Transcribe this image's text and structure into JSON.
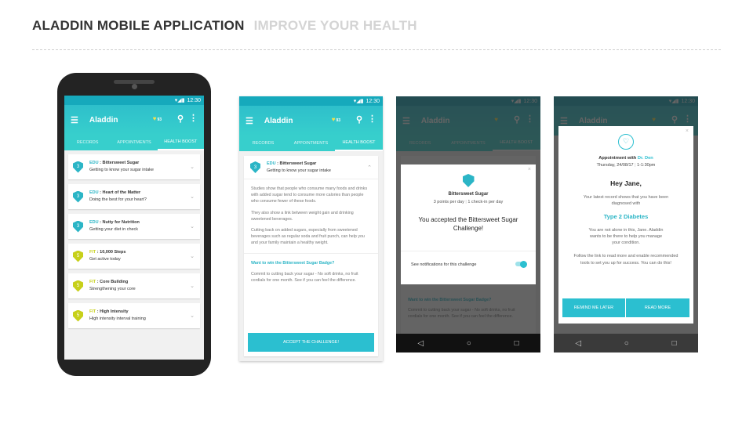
{
  "header": {
    "title": "ALADDIN MOBILE APPLICATION",
    "subtitle": "IMPROVE YOUR HEALTH"
  },
  "colors": {
    "teal": "#2ebfcb",
    "fit": "#c7d01a",
    "edu": "#2bb5c6"
  },
  "app": {
    "title": "Aladdin",
    "points": "93",
    "time": "12:30",
    "status_icons": "▾◢▮",
    "tabs": [
      "RECORDS",
      "APPOINTMENTS",
      "HEALTH BOOST"
    ]
  },
  "cards": [
    {
      "cat": "EDU",
      "title": "Bittersweet Sugar",
      "sub": "Getting to know your sugar intake",
      "num": "3",
      "type": "edu"
    },
    {
      "cat": "EDU",
      "title": "Heart of the Matter",
      "sub": "Doing the best for your heart?",
      "num": "3",
      "type": "edu"
    },
    {
      "cat": "EDU",
      "title": "Nutty for Nutrition",
      "sub": "Getting your diet in check",
      "num": "3",
      "type": "edu"
    },
    {
      "cat": "FIT",
      "title": "10,000 Steps",
      "sub": "Get active today",
      "num": "5",
      "type": "fit"
    },
    {
      "cat": "FIT",
      "title": "Core Building",
      "sub": "Strengthening your core",
      "num": "5",
      "type": "fit"
    },
    {
      "cat": "FIT",
      "title": "High Intensity",
      "sub": "High intensity interval training",
      "num": "5",
      "type": "fit"
    }
  ],
  "detail": {
    "cat": "EDU",
    "title": "Bittersweet Sugar",
    "sub": "Getting to know your sugar intake",
    "p1": "Studies show that people who consume many foods and drinks with added sugar tend to consume more calories than people who consume fewer of these foods.",
    "p2": "They also show a link between weight gain and drinking sweetened beverages.",
    "p3": "Cutting back on added sugars, especially from sweetened beverages such as regular soda and fruit punch, can help you and your family maintain a healthy weight.",
    "badge_q": "Want to win the Bittersweet Sugar Badge?",
    "badge_text": "Commit to cutting back your sugar - No soft drinks, no fruit cordials for one month. See if you can feel the difference.",
    "cta": "ACCEPT THE CHALLENGE!"
  },
  "challenge": {
    "title": "Bittersweet Sugar",
    "points": "3 points per day",
    "checkin": "1 check-in per day",
    "accepted": "You accepted the Bittersweet Sugar Challenge!",
    "notif": "See notifications for this challenge",
    "notif_on": true
  },
  "appointment": {
    "label": "Appointment with",
    "doctor": "Dr. Den",
    "date": "Thursday, 24/08/17",
    "time": "1-1:30pm",
    "greet": "Hey Jane,",
    "p1": "Your latest record shows that you have been diagnosed with",
    "diagnosis": "Type 2 Diabetes",
    "p2": "You are not alone in this, Jane. Aladdin wants to be there to help you manage your condition.",
    "p3": "Follow the link to read more and enable recommended tools to set you up for success. You can do this!",
    "remind": "REMIND ME LATER",
    "read": "READ MORE"
  }
}
